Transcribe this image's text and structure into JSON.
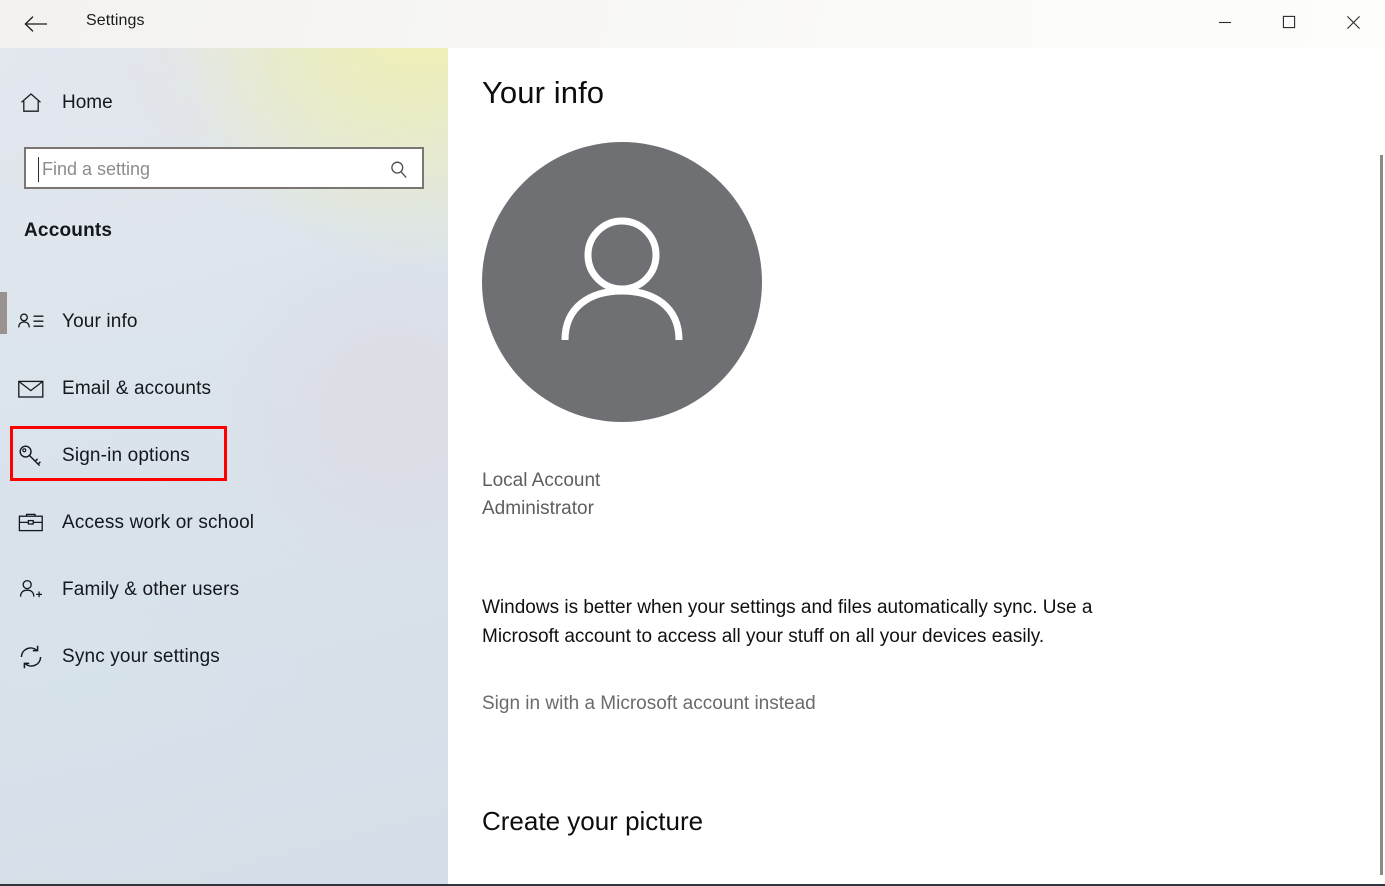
{
  "titlebar": {
    "title": "Settings",
    "back_icon": "back-arrow-icon",
    "minimize_label": "—",
    "maximize_label": "□",
    "close_label": "✕"
  },
  "sidebar": {
    "home": {
      "label": "Home",
      "icon": "home-icon"
    },
    "search": {
      "value": "",
      "placeholder": "Find a setting",
      "icon": "search-icon"
    },
    "section_title": "Accounts",
    "items": [
      {
        "label": "Your info",
        "icon": "user-details-icon",
        "highlighted": false
      },
      {
        "label": "Email & accounts",
        "icon": "envelope-icon",
        "highlighted": false
      },
      {
        "label": "Sign-in options",
        "icon": "key-icon",
        "highlighted": true
      },
      {
        "label": "Access work or school",
        "icon": "briefcase-icon",
        "highlighted": false
      },
      {
        "label": "Family & other users",
        "icon": "add-user-icon",
        "highlighted": false
      },
      {
        "label": "Sync your settings",
        "icon": "sync-icon",
        "highlighted": false
      }
    ]
  },
  "main": {
    "page_title": "Your info",
    "avatar_icon": "person-avatar-icon",
    "account_name": "Local Account",
    "account_role": "Administrator",
    "description": "Windows is better when your settings and files automatically sync. Use a Microsoft account to access all your stuff on all your devices easily.",
    "microsoft_link": "Sign in with a Microsoft account instead",
    "section2_title": "Create your picture"
  },
  "colors": {
    "highlight_box": "#ff0000",
    "avatar_bg": "#6e7073",
    "sidebar_bg": "#dde5ed",
    "content_bg": "#ffffff"
  }
}
